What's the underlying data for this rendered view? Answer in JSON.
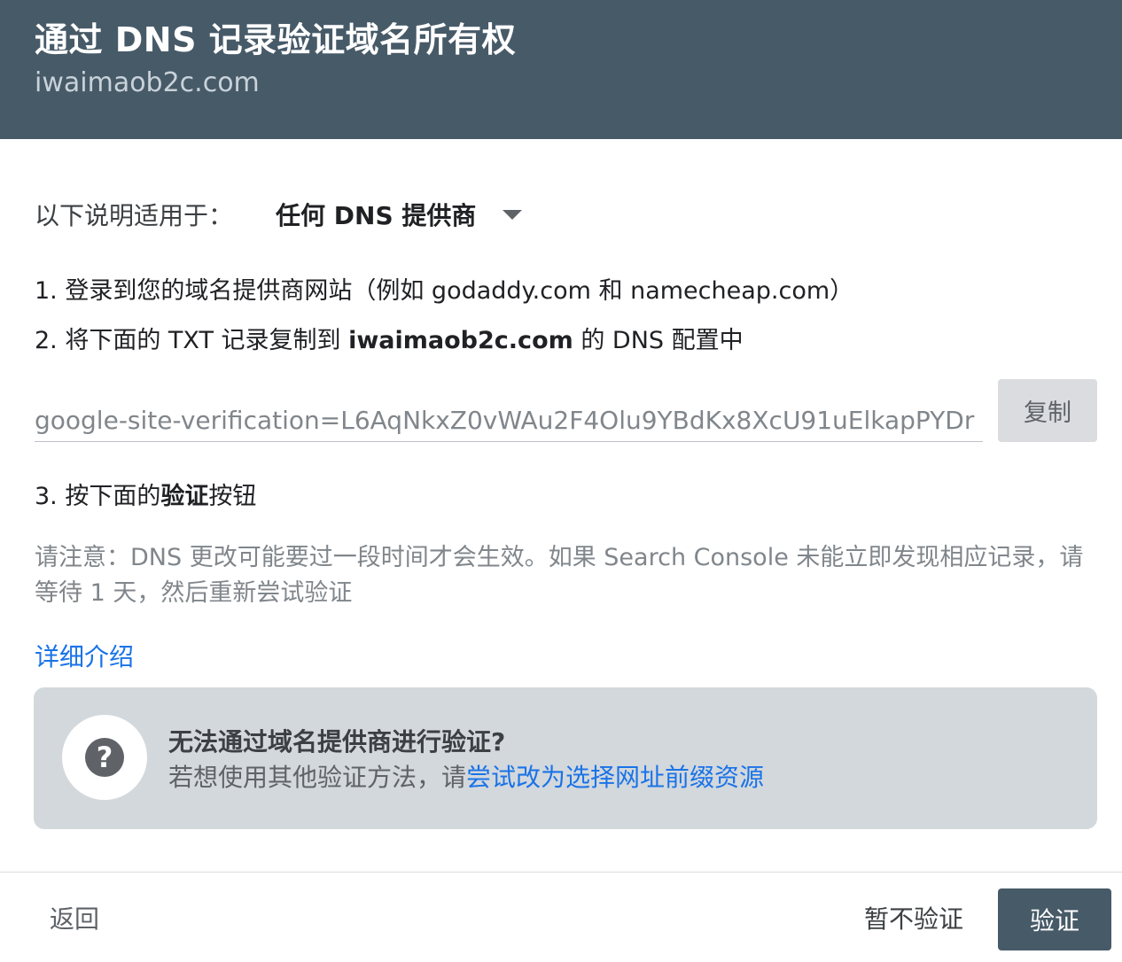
{
  "header": {
    "title": "通过 DNS 记录验证域名所有权",
    "subtitle": "iwaimaob2c.com"
  },
  "provider": {
    "label": "以下说明适用于：",
    "selected": "任何 DNS 提供商",
    "icon": "chevron-down-icon"
  },
  "steps": {
    "step1": "1. 登录到您的域名提供商网站（例如 godaddy.com 和 namecheap.com）",
    "step2_prefix": "2. 将下面的 TXT 记录复制到 ",
    "step2_domain": "iwaimaob2c.com",
    "step2_suffix": " 的 DNS 配置中",
    "step3_prefix": "3. 按下面的",
    "step3_bold": "验证",
    "step3_suffix": "按钮"
  },
  "txt_record": {
    "value": "google-site-verification=L6AqNkxZ0vWAu2F4Olu9YBdKx8XcU91uElkapPYDr"
  },
  "copy_button": "复制",
  "note": "请注意：DNS 更改可能要过一段时间才会生效。如果 Search Console 未能立即发现相应记录，请等待 1 天，然后重新尝试验证",
  "more_link": "详细介绍",
  "help": {
    "icon": "question-icon",
    "title": "无法通过域名提供商进行验证?",
    "text_prefix": "若想使用其他验证方法，请",
    "link": "尝试改为选择网址前缀资源"
  },
  "footer": {
    "back": "返回",
    "skip": "暂不验证",
    "verify": "验证"
  },
  "colors": {
    "header_bg": "#475a68",
    "link": "#1a73e8",
    "help_bg": "#d3d8dc",
    "primary_button": "#475a68"
  }
}
